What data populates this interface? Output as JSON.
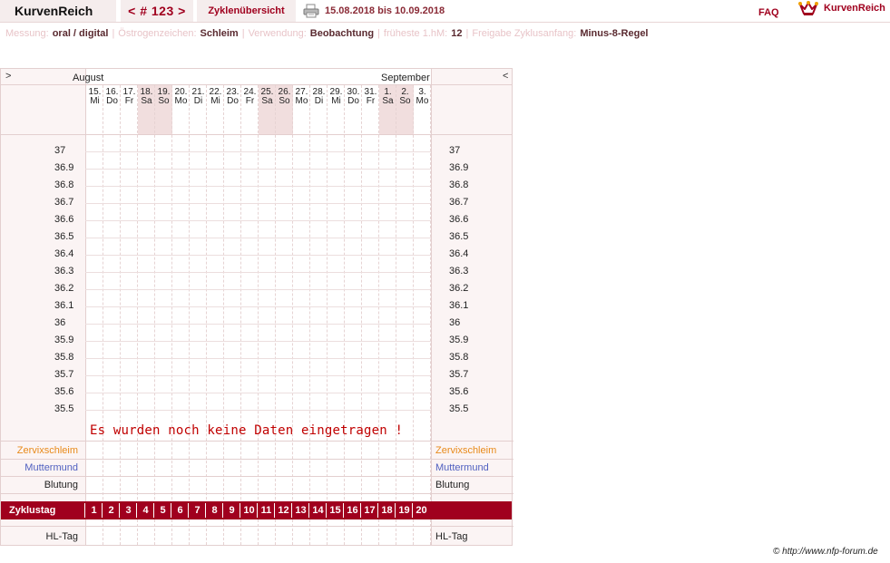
{
  "header": {
    "brand": "KurvenReich",
    "cycle_nav": "< # 123 >",
    "overview_tab": "Zyklenübersicht",
    "print_icon": "printer-icon",
    "date_range": "15.08.2018 bis 10.09.2018",
    "faq": "FAQ",
    "logo_icon": "jester-crown-icon",
    "logo_text": "KurvenReich"
  },
  "settings": {
    "messung_label": "Messung:",
    "messung_value": "oral / digital",
    "oestrogen_label": "Östrogenzeichen:",
    "oestrogen_value": "Schleim",
    "verwendung_label": "Verwendung:",
    "verwendung_value": "Beobachtung",
    "hm_label": "früheste 1.hM:",
    "hm_value": "12",
    "freigabe_label": "Freigabe Zyklusanfang:",
    "freigabe_value": "Minus-8-Regel"
  },
  "chart": {
    "nav_left": ">",
    "nav_right": "<",
    "month_left": "August",
    "month_right": "September",
    "days": [
      {
        "num": "15.",
        "dow": "Mi",
        "weekend": false
      },
      {
        "num": "16.",
        "dow": "Do",
        "weekend": false
      },
      {
        "num": "17.",
        "dow": "Fr",
        "weekend": false
      },
      {
        "num": "18.",
        "dow": "Sa",
        "weekend": true
      },
      {
        "num": "19.",
        "dow": "So",
        "weekend": true
      },
      {
        "num": "20.",
        "dow": "Mo",
        "weekend": false
      },
      {
        "num": "21.",
        "dow": "Di",
        "weekend": false
      },
      {
        "num": "22.",
        "dow": "Mi",
        "weekend": false
      },
      {
        "num": "23.",
        "dow": "Do",
        "weekend": false
      },
      {
        "num": "24.",
        "dow": "Fr",
        "weekend": false
      },
      {
        "num": "25.",
        "dow": "Sa",
        "weekend": true
      },
      {
        "num": "26.",
        "dow": "So",
        "weekend": true
      },
      {
        "num": "27.",
        "dow": "Mo",
        "weekend": false
      },
      {
        "num": "28.",
        "dow": "Di",
        "weekend": false
      },
      {
        "num": "29.",
        "dow": "Mi",
        "weekend": false
      },
      {
        "num": "30.",
        "dow": "Do",
        "weekend": false
      },
      {
        "num": "31.",
        "dow": "Fr",
        "weekend": false
      },
      {
        "num": "1.",
        "dow": "Sa",
        "weekend": true
      },
      {
        "num": "2.",
        "dow": "So",
        "weekend": true
      },
      {
        "num": "3.",
        "dow": "Mo",
        "weekend": false
      }
    ],
    "temperatures": [
      "37",
      "36.9",
      "36.8",
      "36.7",
      "36.6",
      "36.5",
      "36.4",
      "36.3",
      "36.2",
      "36.1",
      "36",
      "35.9",
      "35.8",
      "35.7",
      "35.6",
      "35.5"
    ],
    "no_data_message": "Es wurden noch keine Daten eingetragen !",
    "rows": {
      "zervixschleim": "Zervixschleim",
      "muttermund": "Muttermund",
      "blutung": "Blutung",
      "zyklustag": "Zyklustag",
      "hl_tag": "HL-Tag"
    },
    "cycle_days": [
      "1",
      "2",
      "3",
      "4",
      "5",
      "6",
      "7",
      "8",
      "9",
      "10",
      "11",
      "12",
      "13",
      "14",
      "15",
      "16",
      "17",
      "18",
      "19",
      "20"
    ],
    "colors": {
      "accent": "#a0001e",
      "zervixschleim": "#e88a1a",
      "muttermund": "#5060c0",
      "no_data": "#c00000"
    }
  },
  "footer": {
    "copyright": "© http://www.nfp-forum.de"
  }
}
